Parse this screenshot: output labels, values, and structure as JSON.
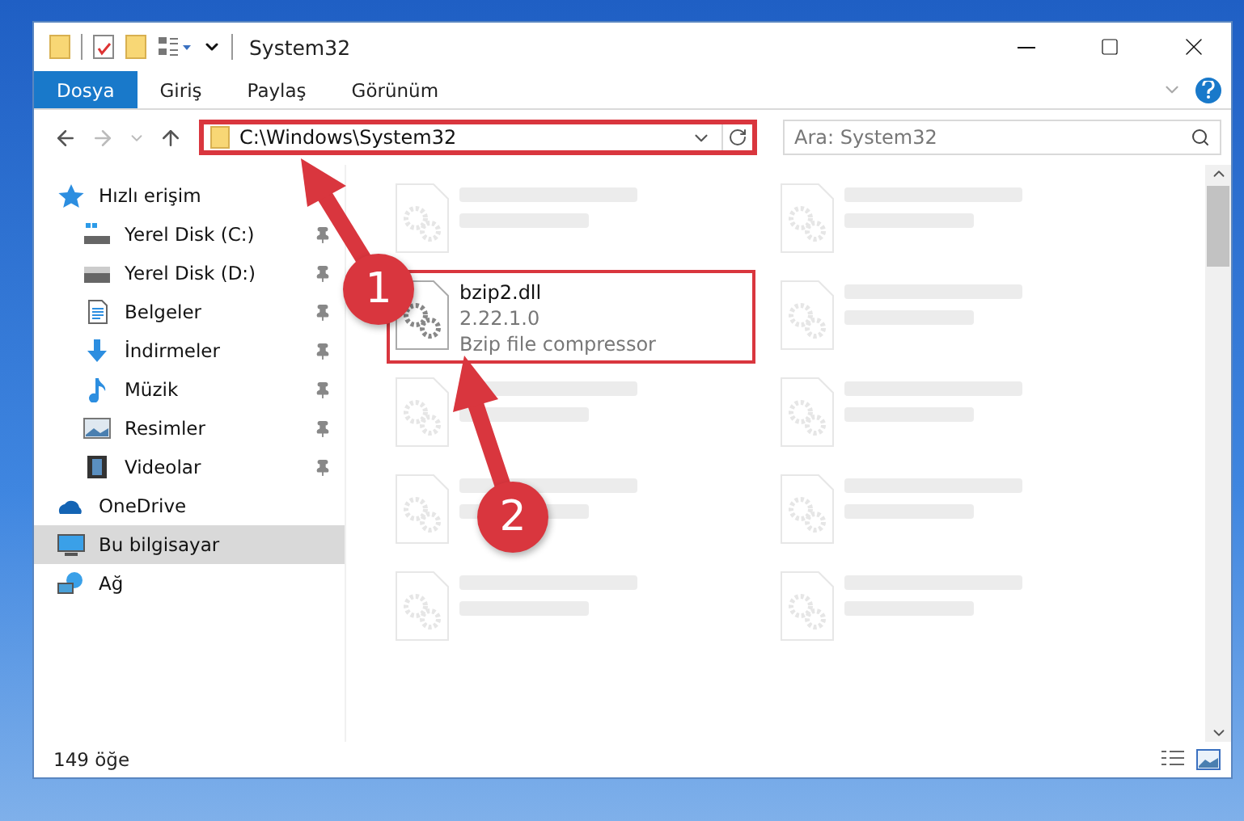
{
  "window": {
    "title": "System32"
  },
  "ribbon_tabs": [
    {
      "label": "Dosya",
      "selected": true
    },
    {
      "label": "Giriş",
      "selected": false
    },
    {
      "label": "Paylaş",
      "selected": false
    },
    {
      "label": "Görünüm",
      "selected": false
    }
  ],
  "address": {
    "path": "C:\\Windows\\System32",
    "highlighted": true
  },
  "search": {
    "placeholder": "Ara: System32"
  },
  "sidebar": {
    "items": [
      {
        "label": "Hızlı erişim",
        "kind": "star",
        "selected": false,
        "children": [
          {
            "label": "Yerel Disk (C:)",
            "kind": "drive-c",
            "pinned": true,
            "selected": false
          },
          {
            "label": "Yerel Disk (D:)",
            "kind": "drive",
            "pinned": true,
            "selected": false
          },
          {
            "label": "Belgeler",
            "kind": "document",
            "pinned": true,
            "selected": false
          },
          {
            "label": "İndirmeler",
            "kind": "download",
            "pinned": true,
            "selected": false
          },
          {
            "label": "Müzik",
            "kind": "music",
            "pinned": true,
            "selected": false
          },
          {
            "label": "Resimler",
            "kind": "image",
            "pinned": true,
            "selected": false
          },
          {
            "label": "Videolar",
            "kind": "video",
            "pinned": true,
            "selected": false
          }
        ]
      },
      {
        "label": "OneDrive",
        "kind": "cloud",
        "selected": false
      },
      {
        "label": "Bu bilgisayar",
        "kind": "computer",
        "selected": true
      },
      {
        "label": "Ağ",
        "kind": "network",
        "selected": false
      }
    ]
  },
  "files": [
    {
      "faded": true,
      "highlighted": false
    },
    {
      "faded": true,
      "highlighted": false
    },
    {
      "name": "bzip2.dll",
      "version": "2.22.1.0",
      "description": "Bzip file compressor",
      "faded": false,
      "highlighted": true
    },
    {
      "faded": true,
      "highlighted": false
    },
    {
      "faded": true,
      "highlighted": false
    },
    {
      "faded": true,
      "highlighted": false
    },
    {
      "faded": true,
      "highlighted": false
    },
    {
      "faded": true,
      "highlighted": false
    },
    {
      "faded": true,
      "highlighted": false
    },
    {
      "faded": true,
      "highlighted": false
    }
  ],
  "status_bar": {
    "item_count": "149 öğe"
  },
  "annotations": [
    {
      "number": "1"
    },
    {
      "number": "2"
    }
  ]
}
